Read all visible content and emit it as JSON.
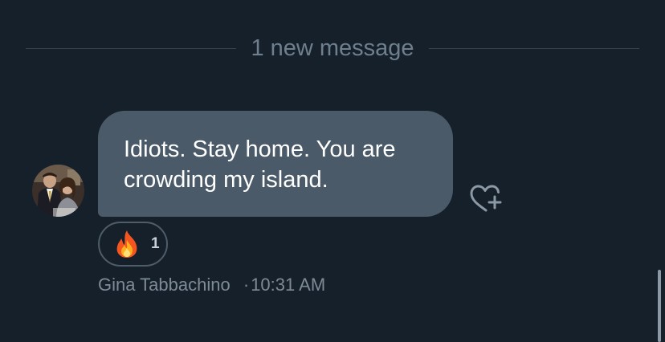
{
  "divider": {
    "label": "1 new message"
  },
  "message": {
    "text": "Idiots. Stay home. You are crowding my island.",
    "reaction": {
      "emoji_icon": "fire-icon",
      "count": "1"
    },
    "sender": "Gina Tabbachino",
    "separator": "·",
    "time": "10:31 AM"
  },
  "colors": {
    "background": "#16202b",
    "bubble": "#4b5a69",
    "divider_line": "#38444d",
    "meta_text": "#7d8b97"
  },
  "icons": {
    "add_reaction": "heart-plus-icon",
    "avatar": "avatar"
  }
}
